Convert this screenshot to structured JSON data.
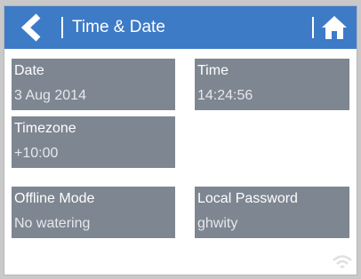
{
  "header": {
    "title": "Time & Date",
    "back_icon": "chevron-left-icon",
    "home_icon": "home-icon",
    "color": "#3e7bc6"
  },
  "tiles": {
    "date": {
      "label": "Date",
      "value": "3 Aug 2014"
    },
    "time": {
      "label": "Time",
      "value": "14:24:56"
    },
    "timezone": {
      "label": "Timezone",
      "value": "+10:00"
    },
    "offline_mode": {
      "label": "Offline Mode",
      "value": "No watering"
    },
    "local_password": {
      "label": "Local Password",
      "value": "ghwity"
    }
  },
  "status": {
    "wifi_icon": "wifi-icon"
  },
  "colors": {
    "tile": "#7e8691",
    "header": "#3e7bc6"
  }
}
